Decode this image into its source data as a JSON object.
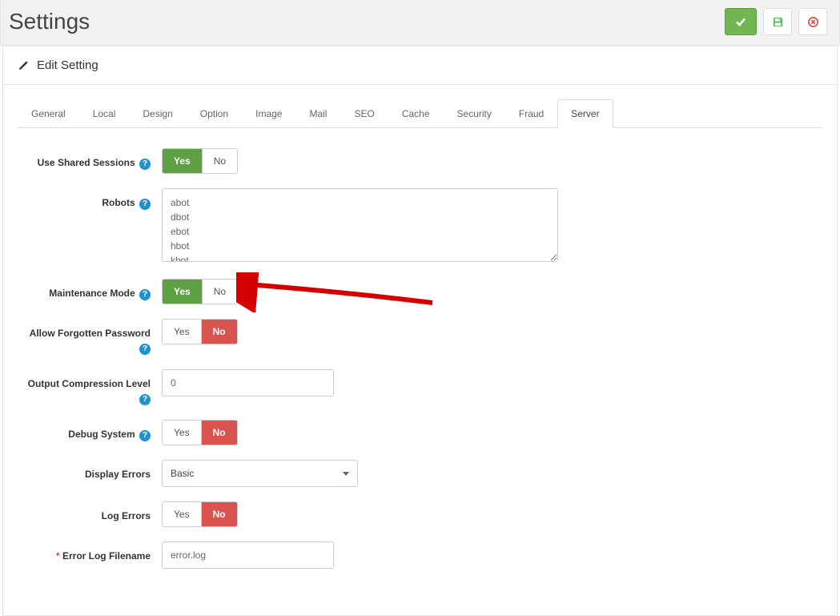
{
  "header": {
    "title": "Settings"
  },
  "panel": {
    "title": "Edit Setting"
  },
  "tabs": [
    "General",
    "Local",
    "Design",
    "Option",
    "Image",
    "Mail",
    "SEO",
    "Cache",
    "Security",
    "Fraud",
    "Server"
  ],
  "active_tab": "Server",
  "labels": {
    "shared_sessions": "Use Shared Sessions",
    "robots": "Robots",
    "maintenance": "Maintenance Mode",
    "forgotten": "Allow Forgotten Password",
    "compression": "Output Compression Level",
    "debug": "Debug System",
    "display_errors": "Display Errors",
    "log_errors": "Log Errors",
    "error_log": "Error Log Filename"
  },
  "toggle": {
    "yes": "Yes",
    "no": "No"
  },
  "values": {
    "robots": "abot\ndbot\nebot\nhbot\nkbot\nlbot",
    "compression": "0",
    "display_errors": "Basic",
    "error_log": "error.log"
  }
}
